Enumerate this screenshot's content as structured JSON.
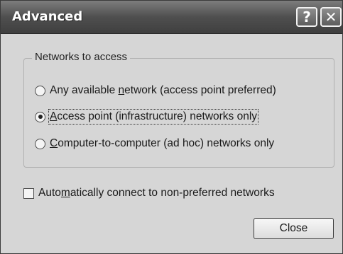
{
  "window": {
    "title": "Advanced",
    "help_glyph": "?",
    "close_glyph": "✕"
  },
  "group": {
    "legend": "Networks to access",
    "options": [
      {
        "pre": "Any available ",
        "accel": "n",
        "post": "etwork (access point preferred)",
        "selected": false
      },
      {
        "pre": "",
        "accel": "A",
        "post": "ccess point (infrastructure) networks only",
        "selected": true
      },
      {
        "pre": "",
        "accel": "C",
        "post": "omputer-to-computer (ad hoc) networks only",
        "selected": false
      }
    ]
  },
  "auto_connect": {
    "pre": "Auto",
    "accel": "m",
    "post": "atically connect to non-preferred networks",
    "checked": false
  },
  "close_button": {
    "label": "Close"
  }
}
